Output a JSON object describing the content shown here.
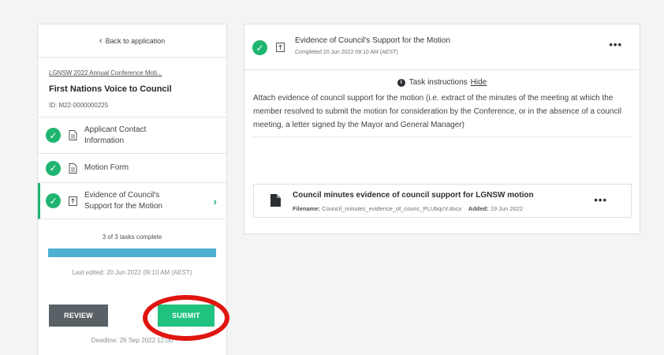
{
  "sidebar": {
    "back_label": "Back to application",
    "application_link": "LGNSW 2022 Annual Conference Moti...",
    "application_title": "First Nations Voice to Council",
    "application_id": "ID: M22-0000000225",
    "tasks": [
      {
        "label": "Applicant Contact Information",
        "status": "complete",
        "icon": "document-icon"
      },
      {
        "label": "Motion Form",
        "status": "complete",
        "icon": "document-icon"
      },
      {
        "label": "Evidence of Council's Support for the Motion",
        "status": "complete",
        "icon": "upload-icon",
        "active": true
      }
    ],
    "progress_text": "3 of 3 tasks complete",
    "progress_fraction": 1.0,
    "last_edited": "Last edited: 20 Jun 2022 09:10 AM (AEST)",
    "review_label": "REVIEW",
    "submit_label": "SUBMIT",
    "deadline": "Deadline: 26 Sep 2022 12:00"
  },
  "task_detail": {
    "title": "Evidence of Council's Support for the Motion",
    "completed": "Completed 20 Jun 2022 09:10 AM (AEST)",
    "more_label": "•••",
    "instructions_label": "Task instructions",
    "hide_label": "Hide",
    "instructions_text": "Attach evidence of council support for the motion (i.e. extract of the minutes of the meeting at which the member resolved to submit the motion for consideration by the Conference, or in the absence of a council meeting, a letter signed by the Mayor and General Manager)",
    "file": {
      "title": "Council minutes evidence of council support for LGNSW motion",
      "filename_label": "Filename:",
      "filename": "Council_minutes_evidence_of_counc_PLUbqcV.docx",
      "added_label": "Added:",
      "added": "19 Jun 2022",
      "more_label": "•••"
    }
  },
  "colors": {
    "success": "#1fb571",
    "submit": "#1fc27e",
    "review": "#5a6166",
    "progress": "#4db0d2",
    "annotation_ring": "#e01510"
  }
}
